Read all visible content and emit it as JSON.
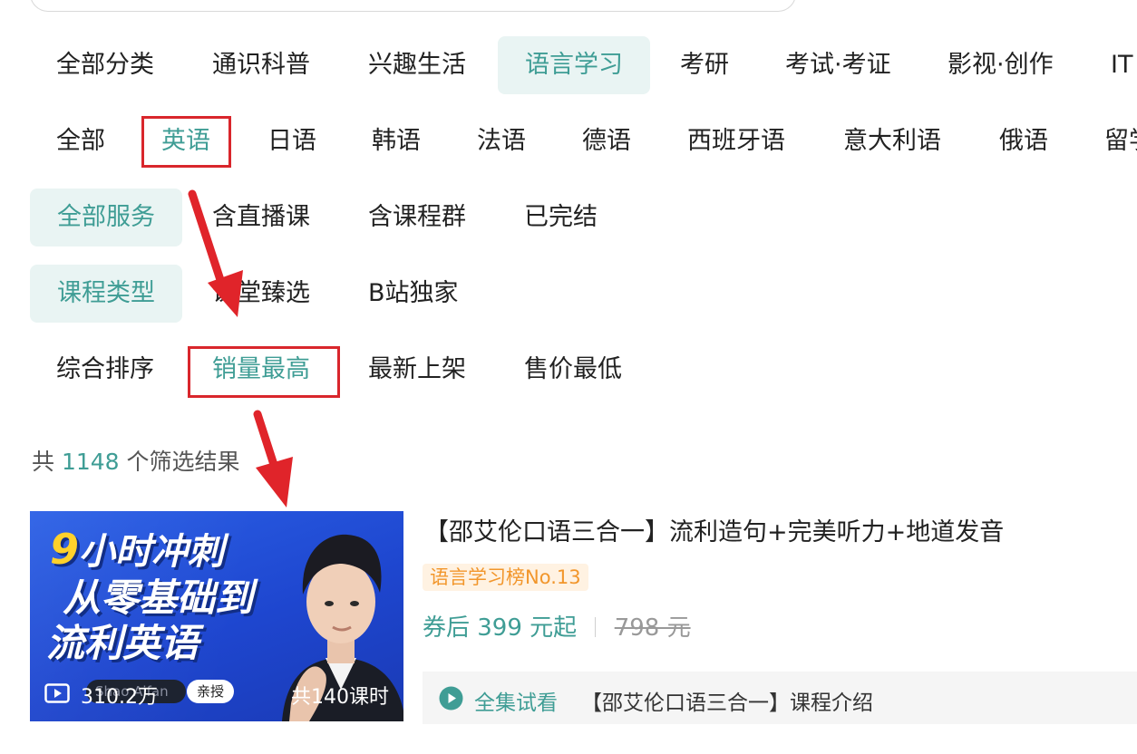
{
  "categories": {
    "items": [
      {
        "label": "全部分类",
        "active": false
      },
      {
        "label": "通识科普",
        "active": false
      },
      {
        "label": "兴趣生活",
        "active": false
      },
      {
        "label": "语言学习",
        "active": true
      },
      {
        "label": "考研",
        "active": false
      },
      {
        "label": "考试·考证",
        "active": false
      },
      {
        "label": "影视·创作",
        "active": false
      },
      {
        "label": "IT",
        "active": false
      }
    ]
  },
  "languages": {
    "items": [
      {
        "label": "全部",
        "active": false
      },
      {
        "label": "英语",
        "active": true
      },
      {
        "label": "日语",
        "active": false
      },
      {
        "label": "韩语",
        "active": false
      },
      {
        "label": "法语",
        "active": false
      },
      {
        "label": "德语",
        "active": false
      },
      {
        "label": "西班牙语",
        "active": false
      },
      {
        "label": "意大利语",
        "active": false
      },
      {
        "label": "俄语",
        "active": false
      },
      {
        "label": "留学",
        "active": false
      }
    ]
  },
  "services": {
    "items": [
      {
        "label": "全部服务",
        "active": true
      },
      {
        "label": "含直播课",
        "active": false
      },
      {
        "label": "含课程群",
        "active": false
      },
      {
        "label": "已完结",
        "active": false
      }
    ]
  },
  "course_types": {
    "items": [
      {
        "label": "课程类型",
        "active": true
      },
      {
        "label": "课堂臻选",
        "active": false
      },
      {
        "label": "B站独家",
        "active": false
      }
    ]
  },
  "sort": {
    "items": [
      {
        "label": "综合排序",
        "active": false
      },
      {
        "label": "销量最高",
        "active": true
      },
      {
        "label": "最新上架",
        "active": false
      },
      {
        "label": "售价最低",
        "active": false
      }
    ]
  },
  "results": {
    "prefix": "共",
    "count": "1148",
    "suffix": "个筛选结果"
  },
  "course": {
    "thumbnail": {
      "line1_number": "9",
      "line1_text": "小时冲刺",
      "line2": "从零基础到",
      "line3": "流利英语",
      "instructor_name": "Shao Aifan",
      "instructor_tag": "亲授",
      "play_count": "310.2万",
      "lessons": "共140课时"
    },
    "title": "【邵艾伦口语三合一】流利造句+完美听力+地道发音",
    "rank_badge": "语言学习榜No.13",
    "price_now": "券后 399 元起",
    "price_old": "798 元",
    "trial_label": "全集试看",
    "trial_title": "【邵艾伦口语三合一】课程介绍"
  },
  "colors": {
    "accent": "#3f9d95",
    "active_bg": "#e9f4f3",
    "highlight_red": "#d9262c",
    "badge_orange": "#f2962b",
    "thumbnail_blue": "#2458e0"
  }
}
